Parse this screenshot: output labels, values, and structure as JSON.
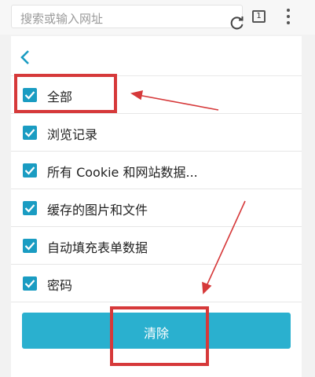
{
  "address_bar": {
    "placeholder": "搜索或输入网址",
    "tab_count": "1"
  },
  "icons": {
    "refresh": "refresh-icon",
    "tabs": "tabs-icon",
    "menu": "more-vert-icon",
    "back": "back-chevron-icon",
    "checkbox": "checkbox-checked-icon"
  },
  "items": [
    {
      "label": "全部",
      "checked": true
    },
    {
      "label": "浏览记录",
      "checked": true
    },
    {
      "label": "所有 Cookie 和网站数据...",
      "checked": true
    },
    {
      "label": "缓存的图片和文件",
      "checked": true
    },
    {
      "label": "自动填充表单数据",
      "checked": true
    },
    {
      "label": "密码",
      "checked": true
    }
  ],
  "clear_button": {
    "label": "清除"
  },
  "colors": {
    "accent": "#2ab0cf",
    "checkbox": "#1a9cc2",
    "annotation": "#d6393a"
  }
}
